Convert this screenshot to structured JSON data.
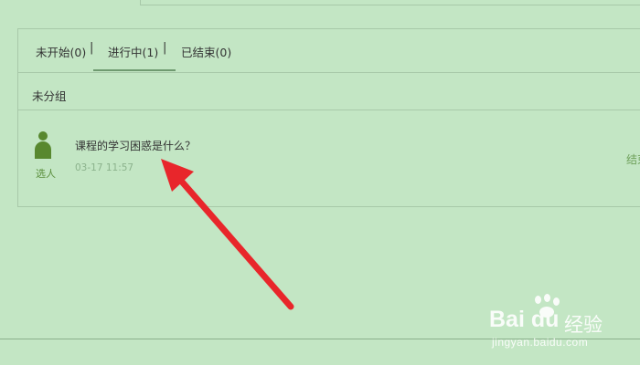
{
  "tabs": [
    {
      "label": "未开始(0)",
      "active": false
    },
    {
      "label": "进行中(1)",
      "active": true
    },
    {
      "label": "已结束(0)",
      "active": false
    }
  ],
  "tab_separator": "|",
  "group": {
    "title": "未分组"
  },
  "activity": {
    "type_label": "选人",
    "title": "课程的学习困惑是什么？",
    "date": "03-17 11:57",
    "action_label": "结束",
    "icon": "person-icon"
  },
  "watermark": {
    "brand": "Bai du",
    "brand_cn": "经验",
    "url": "jingyan.baidu.com"
  },
  "colors": {
    "background": "#c3e6c4",
    "accent_green": "#58882f",
    "arrow_red": "#e8262b"
  }
}
